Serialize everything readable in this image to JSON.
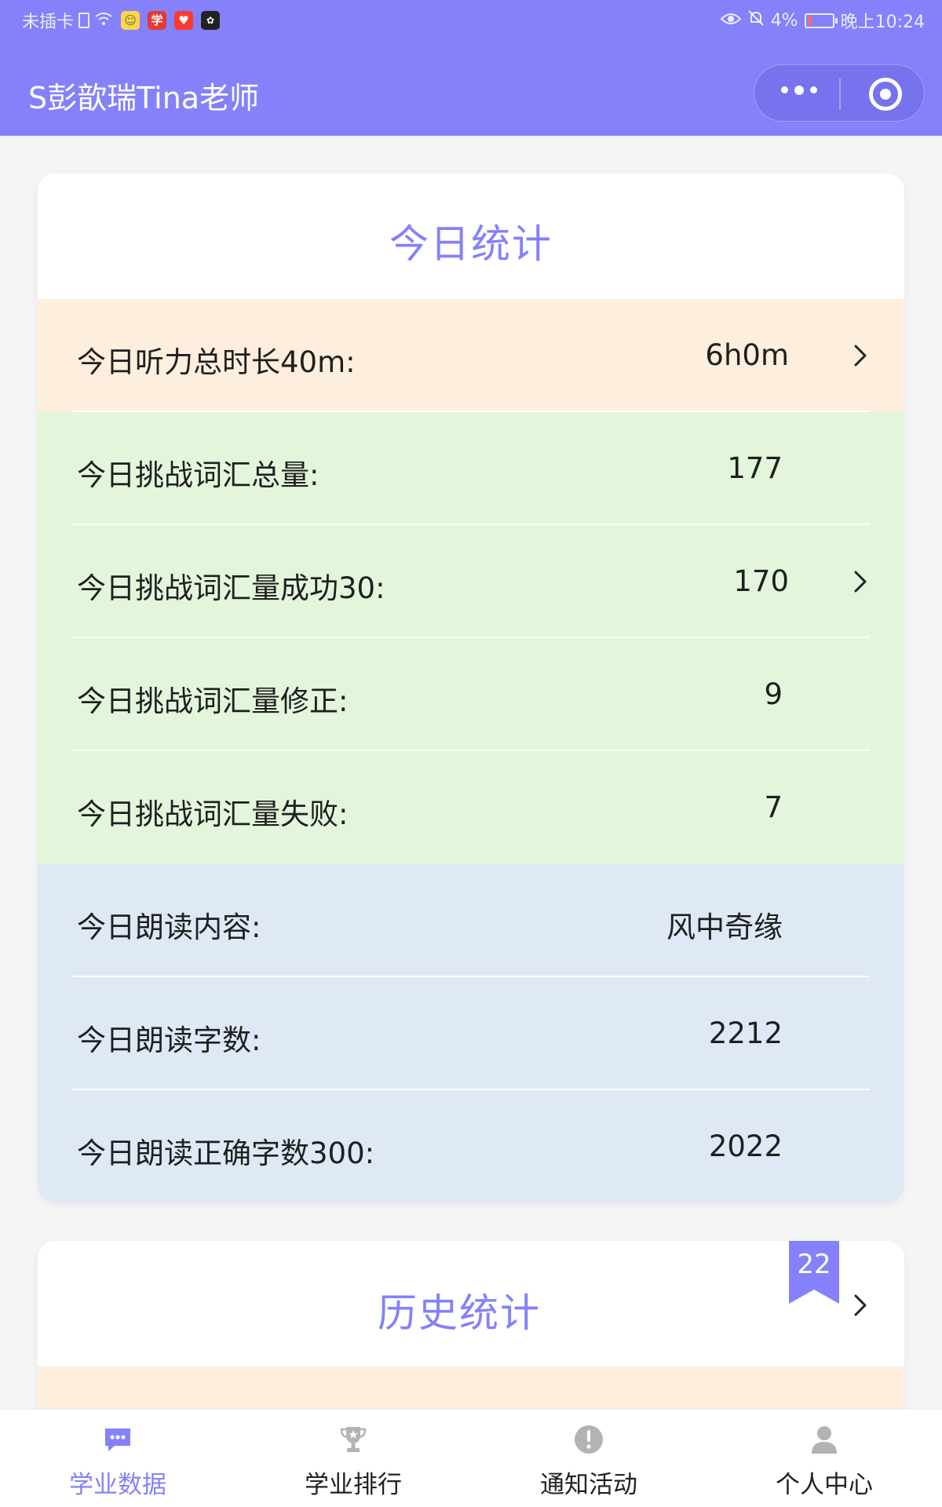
{
  "status_bar": {
    "carrier": "未插卡",
    "battery": "4%",
    "time": "晚上10:24"
  },
  "nav": {
    "title": "S彭歆瑞Tina老师"
  },
  "today": {
    "title": "今日统计",
    "rows": [
      {
        "label": "今日听力总时长40m:",
        "value": "6h0m",
        "tone": "peach",
        "chevron": true
      },
      {
        "label": "今日挑战词汇总量:",
        "value": "177",
        "tone": "green",
        "chevron": false
      },
      {
        "label": "今日挑战词汇量成功30:",
        "value": "170",
        "tone": "green",
        "chevron": true
      },
      {
        "label": "今日挑战词汇量修正:",
        "value": "9",
        "tone": "green",
        "chevron": false
      },
      {
        "label": "今日挑战词汇量失败:",
        "value": "7",
        "tone": "green",
        "chevron": false
      },
      {
        "label": "今日朗读内容:",
        "value": "风中奇缘",
        "tone": "blue",
        "chevron": false
      },
      {
        "label": "今日朗读字数:",
        "value": "2212",
        "tone": "blue",
        "chevron": false
      },
      {
        "label": "今日朗读正确字数300:",
        "value": "2022",
        "tone": "blue",
        "chevron": false
      }
    ]
  },
  "history": {
    "title": "历史统计",
    "badge": "22"
  },
  "tabs": [
    {
      "label": "学业数据",
      "icon": "chat-bubble-icon",
      "active": true
    },
    {
      "label": "学业排行",
      "icon": "trophy-icon",
      "active": false
    },
    {
      "label": "通知活动",
      "icon": "exclamation-icon",
      "active": false
    },
    {
      "label": "个人中心",
      "icon": "person-icon",
      "active": false
    }
  ],
  "colors": {
    "accent": "#8481fb",
    "peach": "#feeedd",
    "green": "#e3f6dc",
    "blue": "#dfe8f5",
    "inactive_icon": "#b3b3b3"
  }
}
